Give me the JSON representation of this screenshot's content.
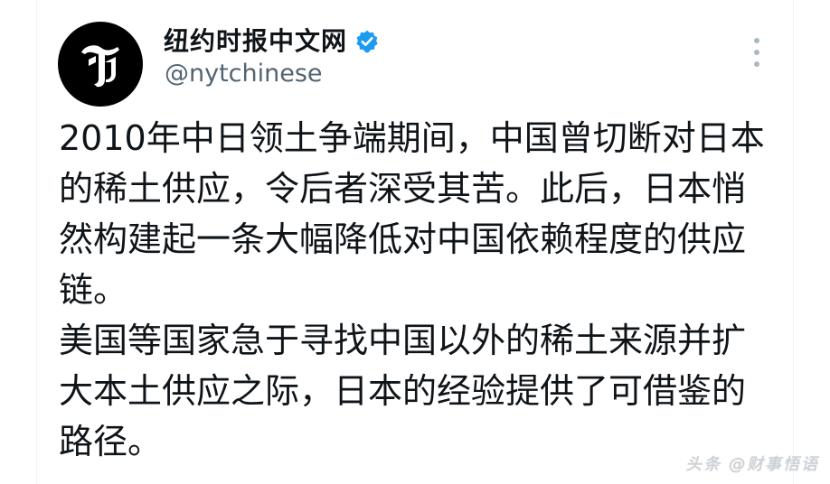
{
  "account": {
    "display_name": "纽约时报中文网",
    "handle": "@nytchinese",
    "verified": true,
    "avatar_icon": "nyt-t-logo-icon",
    "verified_icon": "verified-badge-icon",
    "verified_color": "#1d9bf0"
  },
  "post": {
    "paragraphs": [
      "2010年中日领土争端期间，中国曾切断对日本的稀土供应，令后者深受其苦。此后，日本悄然构建起一条大幅降低对中国依赖程度的供应链。",
      "美国等国家急于寻找中国以外的稀土来源并扩大本土供应之际，日本的经验提供了可借鉴的路径。"
    ]
  },
  "actions": {
    "more_icon": "more-vertical-icon"
  },
  "watermark": {
    "text": "头条 @财事悟语"
  }
}
